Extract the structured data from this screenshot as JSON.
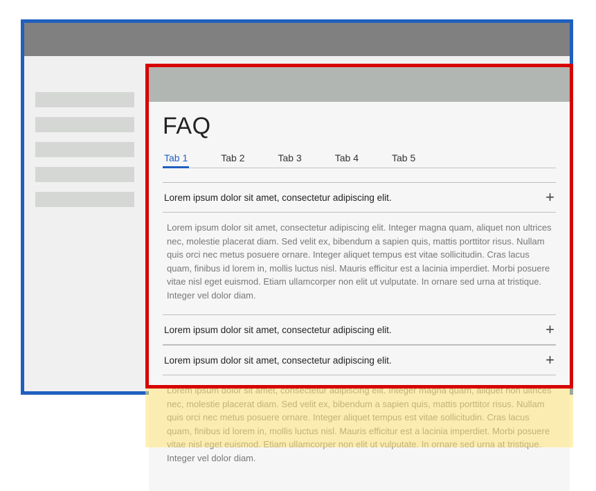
{
  "page_title": "FAQ",
  "tabs": [
    {
      "label": "Tab 1",
      "active": true
    },
    {
      "label": "Tab 2",
      "active": false
    },
    {
      "label": "Tab 3",
      "active": false
    },
    {
      "label": "Tab 4",
      "active": false
    },
    {
      "label": "Tab 5",
      "active": false
    }
  ],
  "accordion": [
    {
      "title": "Lorem ipsum dolor sit amet, consectetur adipiscing elit.",
      "expanded": true,
      "body": "Lorem ipsum dolor sit amet, consectetur adipiscing elit. Integer magna quam, aliquet non ultrices nec, molestie placerat diam. Sed velit ex, bibendum a sapien quis, mattis porttitor risus. Nullam quis orci nec metus posuere ornare. Integer aliquet tempus est vitae sollicitudin. Cras lacus quam, finibus id lorem in, mollis luctus nisl. Mauris efficitur est a lacinia imperdiet. Morbi posuere vitae nisl eget euismod. Etiam ullamcorper non elit ut vulputate. In ornare sed urna at tristique. Integer vel dolor diam."
    },
    {
      "title": "Lorem ipsum dolor sit amet, consectetur adipiscing elit.",
      "expanded": false,
      "body": ""
    },
    {
      "title": "Lorem ipsum dolor sit amet, consectetur adipiscing elit.",
      "expanded": true,
      "body": "Lorem ipsum dolor sit amet, consectetur adipiscing elit. Integer magna quam, aliquet non ultrices nec, molestie placerat diam. Sed velit ex, bibendum a sapien quis, mattis porttitor risus. Nullam quis orci nec metus posuere ornare. Integer aliquet tempus est vitae sollicitudin. Cras lacus quam, finibus id lorem in, mollis luctus nisl. Mauris efficitur est a lacinia imperdiet. Morbi posuere vitae nisl eget euismod. Etiam ullamcorper non elit ut vulputate. In ornare sed urna at tristique. Integer vel dolor diam."
    }
  ],
  "sidebar_items_count": 5,
  "icons": {
    "expand": "+"
  }
}
